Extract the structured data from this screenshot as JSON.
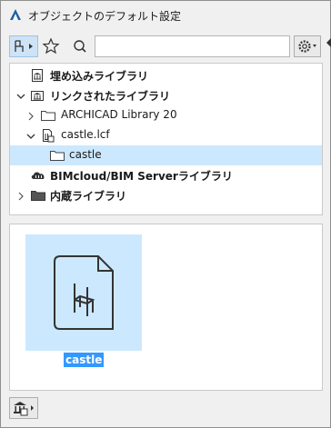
{
  "window": {
    "title": "オブジェクトのデフォルト設定"
  },
  "toolbar": {
    "view_icon": "object-view-icon",
    "favorites_icon": "star-icon",
    "search_icon": "search-icon",
    "search_value": "",
    "settings_icon": "gear-icon"
  },
  "tree": {
    "items": [
      {
        "label": "埋め込みライブラリ",
        "icon": "library-icon",
        "bold": true,
        "expander": "none",
        "selected": false
      },
      {
        "label": "リンクされたライブラリ",
        "icon": "library-icon",
        "bold": true,
        "expander": "expanded",
        "selected": false
      },
      {
        "label": "ARCHICAD Library 20",
        "icon": "folder-icon",
        "bold": false,
        "expander": "collapsed",
        "selected": false
      },
      {
        "label": "castle.lcf",
        "icon": "lcf-file-icon",
        "bold": false,
        "expander": "expanded",
        "selected": false
      },
      {
        "label": "castle",
        "icon": "folder-icon",
        "bold": false,
        "expander": "none",
        "selected": true
      },
      {
        "label": "BIMcloud/BIM Serverライブラリ",
        "icon": "cloud-library-icon",
        "bold": true,
        "expander": "none",
        "selected": false
      },
      {
        "label": "内蔵ライブラリ",
        "icon": "folder-dark-icon",
        "bold": true,
        "expander": "collapsed",
        "selected": false
      }
    ]
  },
  "preview": {
    "items": [
      {
        "label": "castle",
        "icon": "chair-document-icon",
        "selected": true
      }
    ]
  },
  "footer": {
    "library_manager_icon": "library-manager-icon"
  },
  "colors": {
    "selection": "#cce8ff",
    "label_highlight": "#3399ff",
    "accent": "#1f5fa8"
  }
}
